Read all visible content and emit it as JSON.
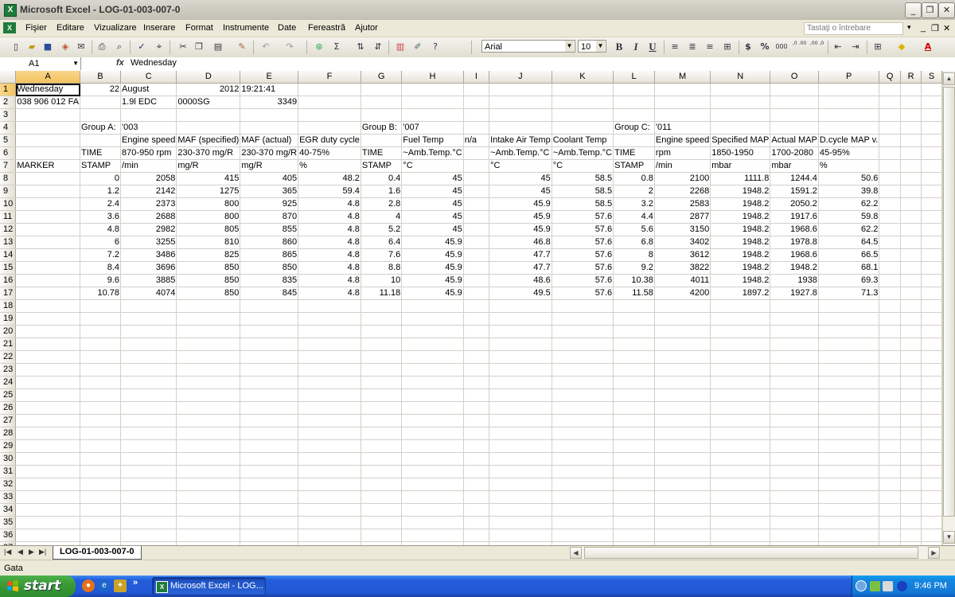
{
  "window": {
    "title": "Microsoft Excel - LOG-01-003-007-0",
    "minimize": "_",
    "restore": "❐",
    "close": "✕"
  },
  "menu": {
    "items": [
      "Fişier",
      "Editare",
      "Vizualizare",
      "Inserare",
      "Format",
      "Instrumente",
      "Date",
      "Fereastră",
      "Ajutor"
    ],
    "help_placeholder": "Tastaţi o întrebare",
    "doc_controls": [
      "▾",
      "_",
      "❐",
      "✕"
    ]
  },
  "toolbar": {
    "font": "Arial",
    "size": "10",
    "bold": "B",
    "italic": "I",
    "underline": "U",
    "currency": "$",
    "percent": "%",
    "thousands": "000",
    "inc_decimal": ",0 .00",
    "dec_decimal": ",00 ,0",
    "font_color": "A"
  },
  "formula_bar": {
    "cell_ref": "A1",
    "fx": "fx",
    "value": "Wednesday"
  },
  "columns": [
    "A",
    "B",
    "C",
    "D",
    "E",
    "F",
    "G",
    "H",
    "I",
    "J",
    "K",
    "L",
    "M",
    "N",
    "O",
    "P",
    "Q",
    "R",
    "S"
  ],
  "row_count": 37,
  "active_cell": "A1",
  "rows": [
    [
      "Wednesday",
      "22",
      "August",
      "2012",
      "19:21:41",
      "",
      "",
      "",
      "",
      "",
      "",
      "",
      "",
      "",
      "",
      "",
      "",
      "",
      ""
    ],
    [
      "038 906 012 FA",
      "",
      "1.9l EDC",
      "0000SG",
      "3349",
      "",
      "",
      "",
      "",
      "",
      "",
      "",
      "",
      "",
      "",
      "",
      "",
      "",
      ""
    ],
    [
      "",
      "",
      "",
      "",
      "",
      "",
      "",
      "",
      "",
      "",
      "",
      "",
      "",
      "",
      "",
      "",
      "",
      "",
      ""
    ],
    [
      "",
      "Group A:",
      "'003",
      "",
      "",
      "",
      "Group B:",
      "'007",
      "",
      "",
      "",
      "Group C:",
      "'011",
      "",
      "",
      "",
      "",
      "",
      ""
    ],
    [
      "",
      "",
      "Engine speed",
      "MAF (specified)",
      "MAF (actual)",
      "EGR duty cycle",
      "",
      "Fuel Temp",
      "n/a",
      "Intake Air Temp",
      "Coolant Temp",
      "",
      "Engine speed",
      "Specified MAP",
      "Actual MAP",
      "D.cycle MAP v.",
      "",
      "",
      ""
    ],
    [
      "",
      "TIME",
      "870-950 rpm",
      "230-370 mg/R",
      "230-370 mg/R",
      "40-75%",
      "TIME",
      "~Amb.Temp.°C",
      "",
      "~Amb.Temp.°C",
      "~Amb.Temp.°C",
      "TIME",
      "rpm",
      "1850-1950",
      "1700-2080",
      "45-95%",
      "",
      "",
      ""
    ],
    [
      "MARKER",
      "STAMP",
      "/min",
      "mg/R",
      "mg/R",
      "%",
      "STAMP",
      "°C",
      "",
      "°C",
      "°C",
      "STAMP",
      "/min",
      "mbar",
      "mbar",
      "%",
      "",
      "",
      ""
    ],
    [
      "",
      "0",
      "2058",
      "415",
      "405",
      "48.2",
      "0.4",
      "45",
      "",
      "45",
      "58.5",
      "0.8",
      "2100",
      "1111.8",
      "1244.4",
      "50.6",
      "",
      "",
      ""
    ],
    [
      "",
      "1.2",
      "2142",
      "1275",
      "365",
      "59.4",
      "1.6",
      "45",
      "",
      "45",
      "58.5",
      "2",
      "2268",
      "1948.2",
      "1591.2",
      "39.8",
      "",
      "",
      ""
    ],
    [
      "",
      "2.4",
      "2373",
      "800",
      "925",
      "4.8",
      "2.8",
      "45",
      "",
      "45.9",
      "58.5",
      "3.2",
      "2583",
      "1948.2",
      "2050.2",
      "62.2",
      "",
      "",
      ""
    ],
    [
      "",
      "3.6",
      "2688",
      "800",
      "870",
      "4.8",
      "4",
      "45",
      "",
      "45.9",
      "57.6",
      "4.4",
      "2877",
      "1948.2",
      "1917.6",
      "59.8",
      "",
      "",
      ""
    ],
    [
      "",
      "4.8",
      "2982",
      "805",
      "855",
      "4.8",
      "5.2",
      "45",
      "",
      "45.9",
      "57.6",
      "5.6",
      "3150",
      "1948.2",
      "1968.6",
      "62.2",
      "",
      "",
      ""
    ],
    [
      "",
      "6",
      "3255",
      "810",
      "860",
      "4.8",
      "6.4",
      "45.9",
      "",
      "46.8",
      "57.6",
      "6.8",
      "3402",
      "1948.2",
      "1978.8",
      "64.5",
      "",
      "",
      ""
    ],
    [
      "",
      "7.2",
      "3486",
      "825",
      "865",
      "4.8",
      "7.6",
      "45.9",
      "",
      "47.7",
      "57.6",
      "8",
      "3612",
      "1948.2",
      "1968.6",
      "66.5",
      "",
      "",
      ""
    ],
    [
      "",
      "8.4",
      "3696",
      "850",
      "850",
      "4.8",
      "8.8",
      "45.9",
      "",
      "47.7",
      "57.6",
      "9.2",
      "3822",
      "1948.2",
      "1948.2",
      "68.1",
      "",
      "",
      ""
    ],
    [
      "",
      "9.6",
      "3885",
      "850",
      "835",
      "4.8",
      "10",
      "45.9",
      "",
      "48.6",
      "57.6",
      "10.38",
      "4011",
      "1948.2",
      "1938",
      "69.3",
      "",
      "",
      ""
    ],
    [
      "",
      "10.78",
      "4074",
      "850",
      "845",
      "4.8",
      "11.18",
      "45.9",
      "",
      "49.5",
      "57.6",
      "11.58",
      "4200",
      "1897.2",
      "1927.8",
      "71.3",
      "",
      "",
      ""
    ]
  ],
  "sheet_tab": {
    "name": "LOG-01-003-007-0"
  },
  "status": {
    "text": "Gata"
  },
  "taskbar": {
    "start": "start",
    "task": "Microsoft Excel - LOG...",
    "clock": "9:46 PM",
    "more": "»"
  }
}
